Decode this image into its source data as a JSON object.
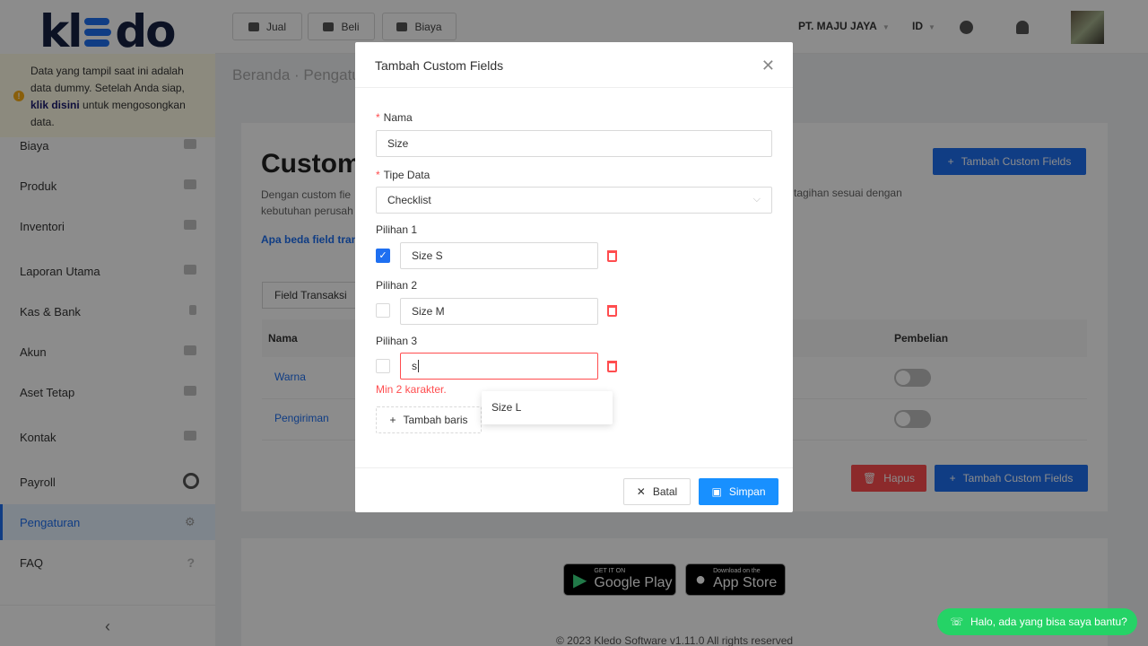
{
  "sidebar": {
    "logo": "kledo",
    "banner_text_1": "Data yang tampil saat ini adalah data dummy. Setelah Anda siap, ",
    "banner_link": "klik disini",
    "banner_text_2": " untuk mengosongkan data.",
    "items": [
      {
        "label": "Biaya"
      },
      {
        "label": "Produk"
      },
      {
        "label": "Inventori"
      },
      {
        "label": "Laporan Utama"
      },
      {
        "label": "Kas & Bank"
      },
      {
        "label": "Akun"
      },
      {
        "label": "Aset Tetap"
      },
      {
        "label": "Kontak"
      },
      {
        "label": "Payroll"
      },
      {
        "label": "Pengaturan"
      },
      {
        "label": "FAQ"
      }
    ],
    "collapse_icon": "chevron-left-icon"
  },
  "topbar": {
    "buttons": [
      {
        "label": "Jual",
        "icon": "shop-icon"
      },
      {
        "label": "Beli",
        "icon": "bag-icon"
      },
      {
        "label": "Biaya",
        "icon": "card-icon"
      }
    ],
    "company": "PT. MAJU JAYA",
    "lang": "ID"
  },
  "content": {
    "breadcrumb_home": "Beranda",
    "breadcrumb_sep": "·",
    "breadcrumb_current": "Pengatu",
    "title": "Custom",
    "desc_1": "Dengan custom fie",
    "desc_2": "kebutuhan perusah",
    "desc_right": "tagihan sesuai dengan",
    "link": "Apa beda field tran",
    "add_button": "Tambah Custom Fields",
    "tab": "Field Transaksi",
    "col_nama": "Nama",
    "col_pembelian": "Pembelian",
    "rows": [
      {
        "name": "Warna"
      },
      {
        "name": "Pengiriman"
      }
    ],
    "delete_button": "Hapus",
    "add_button_bottom": "Tambah Custom Fields",
    "google_play_small": "GET IT ON",
    "google_play": "Google Play",
    "app_store_small": "Download on the",
    "app_store": "App Store",
    "copyright": "© 2023 Kledo Software v1.11.0 All rights reserved",
    "chat": "Halo, ada yang bisa saya bantu?"
  },
  "modal": {
    "title": "Tambah Custom Fields",
    "nama_label": "Nama",
    "nama_value": "Size",
    "tipe_label": "Tipe Data",
    "tipe_value": "Checklist",
    "pilihan": [
      {
        "label": "Pilihan 1",
        "value": "Size S",
        "checked": true
      },
      {
        "label": "Pilihan 2",
        "value": "Size M",
        "checked": false
      },
      {
        "label": "Pilihan 3",
        "value": "s",
        "checked": false
      }
    ],
    "error": "Min 2 karakter.",
    "add_row": "Tambah baris",
    "suggestion": "Size L",
    "cancel": "Batal",
    "save": "Simpan"
  }
}
